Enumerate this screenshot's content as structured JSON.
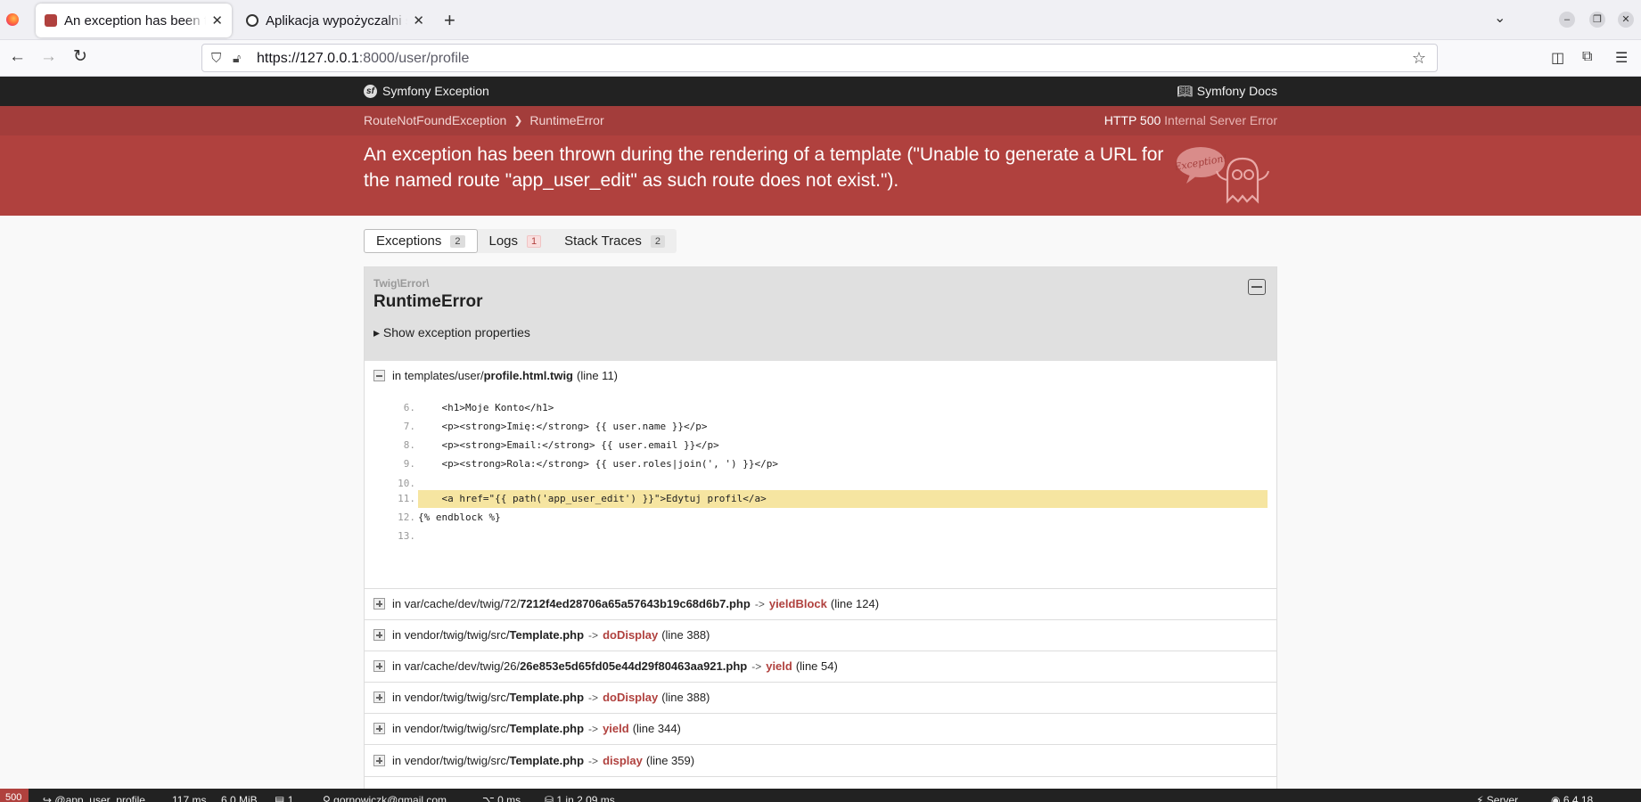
{
  "browser": {
    "tabs": [
      {
        "label": "An exception has been thrown",
        "active": true
      },
      {
        "label": "Aplikacja wypożyczalni sa",
        "active": false
      }
    ],
    "url_host": "https://127.0.0.1",
    "url_rest": ":8000/user/profile"
  },
  "symfony": {
    "brand": "Symfony Exception",
    "docs": "Symfony Docs",
    "breadcrumbs": [
      "RouteNotFoundException",
      "RuntimeError"
    ],
    "status_code": "HTTP 500",
    "status_text": "Internal Server Error",
    "message": "An exception has been thrown during the rendering of a template (\"Unable to generate a URL for the named route \"app_user_edit\" as such route does not exist.\").",
    "ghost_text": "Exception!",
    "tabs": [
      {
        "label": "Exceptions",
        "count": "2"
      },
      {
        "label": "Logs",
        "count": "1"
      },
      {
        "label": "Stack Traces",
        "count": "2"
      }
    ],
    "exception": {
      "namespace": "Twig\\Error\\",
      "class": "RuntimeError",
      "properties_toggle": "▸ Show exception properties",
      "first_trace": {
        "prefix": "in templates/user/",
        "file": "profile.html.twig",
        "line": "(line 11)"
      },
      "code": [
        {
          "num": "6.",
          "src": "    <h1>Moje Konto</h1>"
        },
        {
          "num": "7.",
          "src": "    <p><strong>Imię:</strong> {{ user.name }}</p>"
        },
        {
          "num": "8.",
          "src": "    <p><strong>Email:</strong> {{ user.email }}</p>"
        },
        {
          "num": "9.",
          "src": "    <p><strong>Rola:</strong> {{ user.roles|join(', ') }}</p>"
        },
        {
          "num": "10.",
          "src": ""
        },
        {
          "num": "11.",
          "src": "    <a href=\"{{ path('app_user_edit') }}\">Edytuj profil</a>"
        },
        {
          "num": "12.",
          "src": "{% endblock %}"
        },
        {
          "num": "13.",
          "src": ""
        }
      ],
      "traces": [
        {
          "prefix": "in var/cache/dev/twig/72/",
          "file": "7212f4ed28706a65a57643b19c68d6b7.php",
          "fn": "yieldBlock",
          "line": "(line 124)"
        },
        {
          "prefix": "in vendor/twig/twig/src/",
          "file": "Template.php",
          "fn": "doDisplay",
          "line": "(line 388)"
        },
        {
          "prefix": "in var/cache/dev/twig/26/",
          "file": "26e853e5d65fd05e44d29f80463aa921.php",
          "fn": "yield",
          "line": "(line 54)"
        },
        {
          "prefix": "in vendor/twig/twig/src/",
          "file": "Template.php",
          "fn": "doDisplay",
          "line": "(line 388)"
        },
        {
          "prefix": "in vendor/twig/twig/src/",
          "file": "Template.php",
          "fn": "yield",
          "line": "(line 344)"
        },
        {
          "prefix": "in vendor/twig/twig/src/",
          "file": "Template.php",
          "fn": "display",
          "line": "(line 359)"
        }
      ]
    },
    "toolbar": {
      "status": "500",
      "route": "@app_user_profile",
      "time": "117 ms",
      "memory": "6.0 MiB",
      "logs": "1",
      "user": "gornowiczk@gmail.com",
      "cache": "0 ms",
      "db": "1 in 2.09 ms",
      "server": "Server",
      "version": "6.4.18"
    }
  }
}
